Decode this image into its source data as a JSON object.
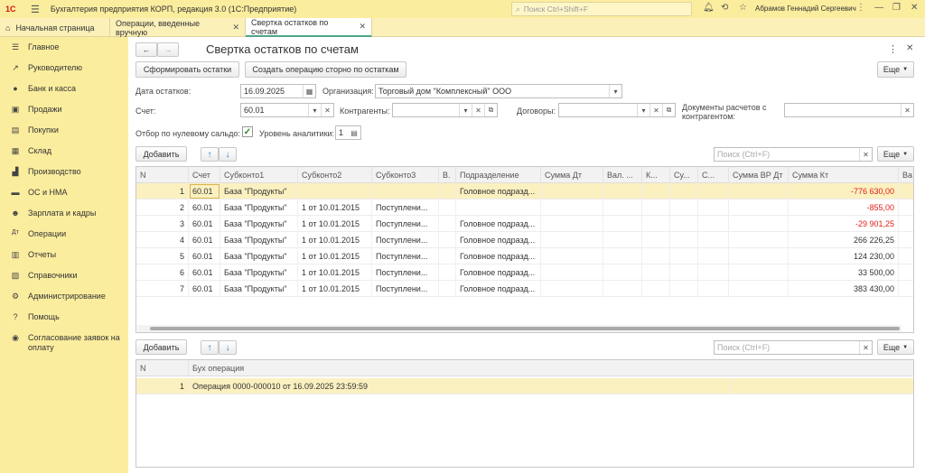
{
  "app": {
    "logo": "1С",
    "title": "Бухгалтерия предприятия КОРП, редакция 3.0  (1С:Предприятие)",
    "search_placeholder": "Поиск Ctrl+Shift+F",
    "user": "Абрамов Геннадий Сергеевич"
  },
  "tabs": [
    {
      "label": "Начальная страница"
    },
    {
      "label": "Операции, введенные вручную"
    },
    {
      "label": "Свертка остатков по счетам"
    }
  ],
  "sidebar": {
    "items": [
      {
        "label": "Главное",
        "icon": "list-icon"
      },
      {
        "label": "Руководителю",
        "icon": "chart-line-icon"
      },
      {
        "label": "Банк и касса",
        "icon": "coin-icon"
      },
      {
        "label": "Продажи",
        "icon": "bag-icon"
      },
      {
        "label": "Покупки",
        "icon": "cart-icon"
      },
      {
        "label": "Склад",
        "icon": "warehouse-icon"
      },
      {
        "label": "Производство",
        "icon": "factory-icon"
      },
      {
        "label": "ОС и НМА",
        "icon": "truck-icon"
      },
      {
        "label": "Зарплата и кадры",
        "icon": "person-icon"
      },
      {
        "label": "Операции",
        "icon": "dt-kt-icon"
      },
      {
        "label": "Отчеты",
        "icon": "report-icon"
      },
      {
        "label": "Справочники",
        "icon": "book-icon"
      },
      {
        "label": "Администрирование",
        "icon": "gear-icon"
      },
      {
        "label": "Помощь",
        "icon": "question-icon"
      },
      {
        "label": "Согласование заявок на оплату",
        "icon": "coin-check-icon"
      }
    ]
  },
  "form": {
    "title": "Свертка остатков по счетам",
    "btn_form_balances": "Сформировать остатки",
    "btn_create_storno": "Создать операцию сторно по остаткам",
    "btn_more": "Еще",
    "date_label": "Дата остатков:",
    "date_value": "16.09.2025",
    "org_label": "Организация:",
    "org_value": "Торговый дом \"Комплексный\" ООО",
    "account_label": "Счет:",
    "account_value": "60.01",
    "counterparties_label": "Контрагенты:",
    "counterparties_value": "",
    "contracts_label": "Договоры:",
    "contracts_value": "",
    "settlement_docs_label": "Документы расчетов с контрагентом:",
    "settlement_docs_value": "",
    "zero_balance_label": "Отбор по нулевому сальдо:",
    "analytics_level_label": "Уровень аналитики:",
    "analytics_level_value": "1"
  },
  "grid1": {
    "add_label": "Добавить",
    "search_placeholder": "Поиск (Ctrl+F)",
    "more_label": "Еще",
    "columns": [
      "N",
      "Счет",
      "Субконто1",
      "Субконто2",
      "Субконто3",
      "В.",
      "Подразделение",
      "Сумма Дт",
      "Вал. ...",
      "К...",
      "Су...",
      "С...",
      "Сумма ВР Дт",
      "Сумма Кт",
      "Ва"
    ],
    "rows": [
      {
        "n": "1",
        "account": "60.01",
        "sub1": "База \"Продукты\"",
        "sub2": "",
        "sub3": "",
        "dept": "Головное подразд...",
        "kt": "-776 630,00",
        "neg": true
      },
      {
        "n": "2",
        "account": "60.01",
        "sub1": "База \"Продукты\"",
        "sub2": "1 от 10.01.2015",
        "sub3": "Поступлени...",
        "dept": "",
        "kt": "-855,00",
        "neg": true
      },
      {
        "n": "3",
        "account": "60.01",
        "sub1": "База \"Продукты\"",
        "sub2": "1 от 10.01.2015",
        "sub3": "Поступлени...",
        "dept": "Головное подразд...",
        "kt": "-29 901,25",
        "neg": true
      },
      {
        "n": "4",
        "account": "60.01",
        "sub1": "База \"Продукты\"",
        "sub2": "1 от 10.01.2015",
        "sub3": "Поступлени...",
        "dept": "Головное подразд...",
        "kt": "266 226,25",
        "neg": false
      },
      {
        "n": "5",
        "account": "60.01",
        "sub1": "База \"Продукты\"",
        "sub2": "1 от 10.01.2015",
        "sub3": "Поступлени...",
        "dept": "Головное подразд...",
        "kt": "124 230,00",
        "neg": false
      },
      {
        "n": "6",
        "account": "60.01",
        "sub1": "База \"Продукты\"",
        "sub2": "1 от 10.01.2015",
        "sub3": "Поступлени...",
        "dept": "Головное подразд...",
        "kt": "33 500,00",
        "neg": false
      },
      {
        "n": "7",
        "account": "60.01",
        "sub1": "База \"Продукты\"",
        "sub2": "1 от 10.01.2015",
        "sub3": "Поступлени...",
        "dept": "Головное подразд...",
        "kt": "383 430,00",
        "neg": false
      }
    ]
  },
  "grid2": {
    "add_label": "Добавить",
    "search_placeholder": "Поиск (Ctrl+F)",
    "more_label": "Еще",
    "columns": [
      "N",
      "Бух операция"
    ],
    "rows": [
      {
        "n": "1",
        "operation": "Операция 0000-000010 от 16.09.2025 23:59:59"
      }
    ]
  }
}
